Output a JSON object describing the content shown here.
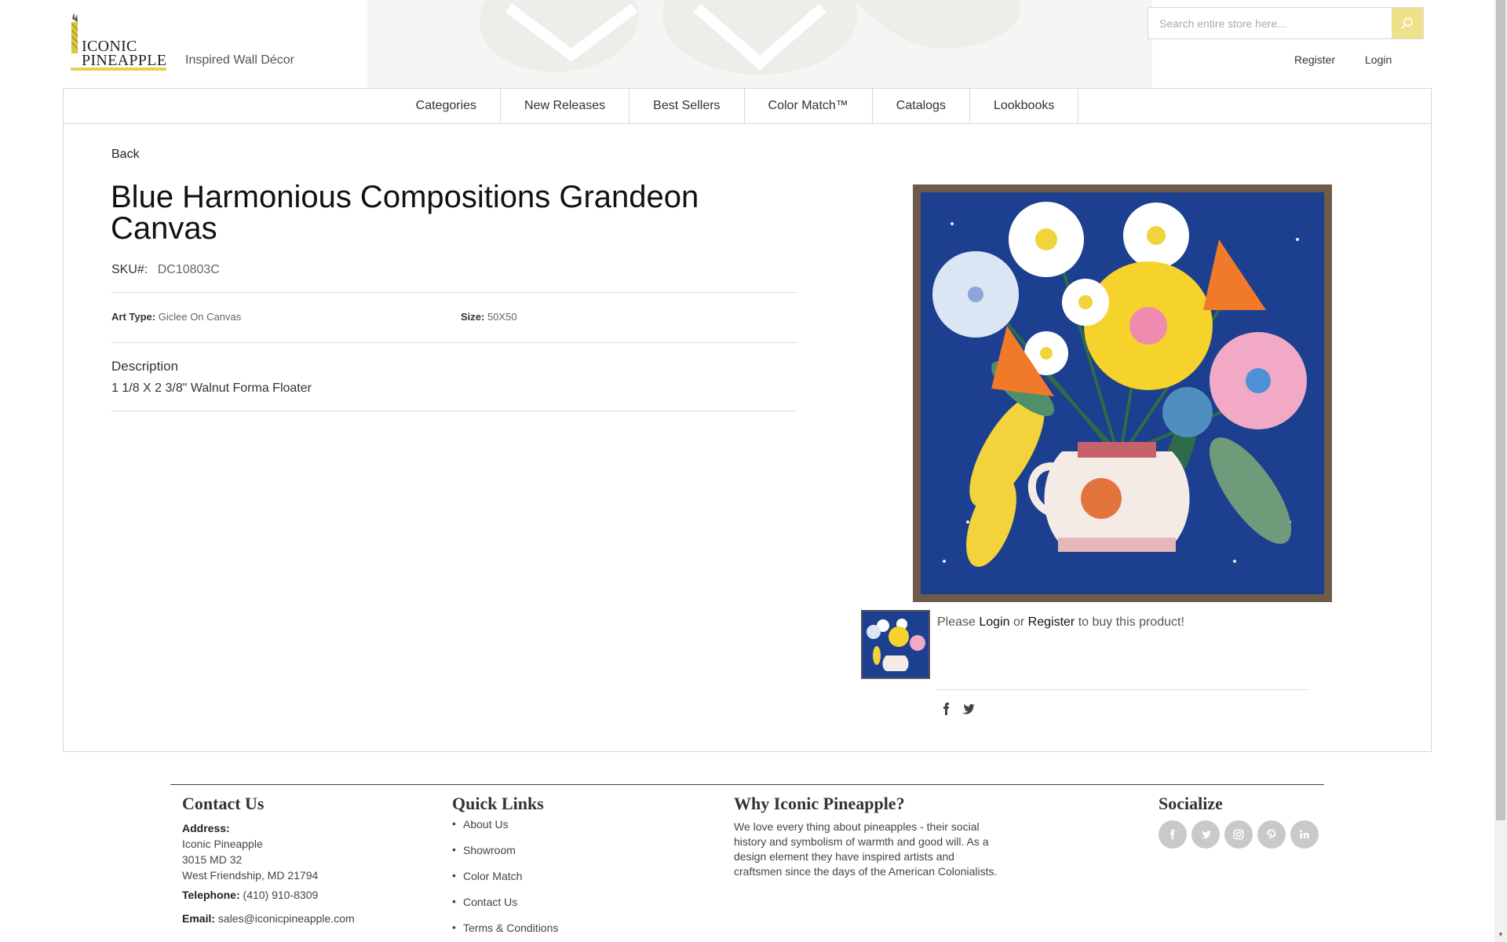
{
  "header": {
    "logo_line1": "ICONIC",
    "logo_line2": "PINEAPPLE",
    "tagline": "Inspired Wall Décor",
    "search_placeholder": "Search entire store here...",
    "register_label": "Register",
    "login_label": "Login"
  },
  "nav": {
    "items": [
      "Categories",
      "New Releases",
      "Best Sellers",
      "Color Match™",
      "Catalogs",
      "Lookbooks"
    ]
  },
  "product": {
    "back_label": "Back",
    "title": "Blue Harmonious Compositions Grandeon Canvas",
    "sku_label": "SKU#:",
    "sku_value": "DC10803C",
    "art_type_label": "Art Type:",
    "art_type_value": "Giclee On Canvas",
    "size_label": "Size:",
    "size_value": "50X50",
    "description_label": "Description",
    "description_value": "1 1/8 X 2 3/8\" Walnut Forma Floater",
    "buy_prefix": "Please",
    "buy_login": "Login",
    "buy_or": "or",
    "buy_register": "Register",
    "buy_suffix": "to buy this product!"
  },
  "footer": {
    "contact_title": "Contact Us",
    "address_label": "Address:",
    "address_lines": [
      "Iconic Pineapple",
      "3015 MD 32",
      "West Friendship, MD 21794"
    ],
    "telephone_label": "Telephone:",
    "telephone_value": "(410) 910-8309",
    "email_label": "Email:",
    "email_value": "sales@iconicpineapple.com",
    "quick_links_title": "Quick Links",
    "quick_links": [
      "About Us",
      "Showroom",
      "Color Match",
      "Contact Us",
      "Terms & Conditions"
    ],
    "why_title": "Why Iconic Pineapple?",
    "why_text": "We love every thing about pineapples - their social history and symbolism of warmth and good will. As a design element they have inspired artists and craftsmen since the days of the American Colonialists.",
    "socialize_title": "Socialize",
    "social_icons": [
      "facebook-icon",
      "twitter-icon",
      "instagram-icon",
      "pinterest-icon",
      "linkedin-icon"
    ]
  },
  "colors": {
    "accent_yellow": "#ede28a",
    "painting_blue": "#1c3f8f",
    "frame_walnut": "#6e5b4a"
  }
}
